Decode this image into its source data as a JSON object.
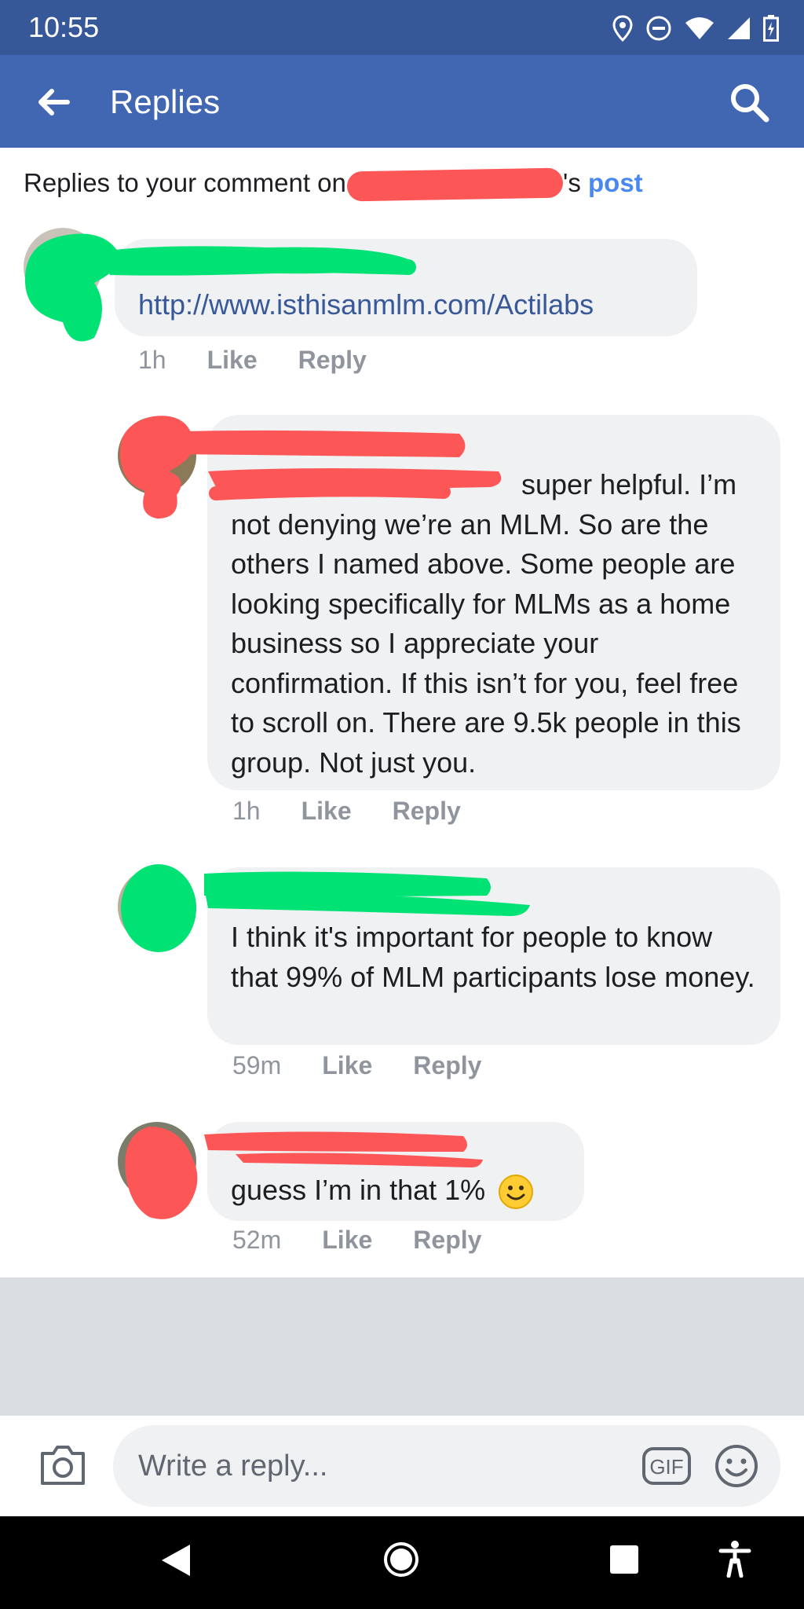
{
  "status_bar": {
    "time": "10:55",
    "icons": [
      "location-icon",
      "do-not-disturb-icon",
      "wifi-icon",
      "signal-icon",
      "battery-icon"
    ]
  },
  "app_bar": {
    "title": "Replies",
    "back_icon": "back-arrow-icon",
    "search_icon": "search-icon"
  },
  "subheader": {
    "prefix": "Replies to your comment on",
    "possessive": "'s",
    "link": "post"
  },
  "comments": [
    {
      "text": "http://www.isthisanmlm.com/Actilabs",
      "time": "1h",
      "like": "Like",
      "reply": "Reply",
      "is_link": true
    },
    {
      "text": "super helpful. I’m not denying we’re an MLM. So are the others I named above. Some people are looking specifically for MLMs as a home business so I appreciate your confirmation. If this isn’t for you, feel free to scroll on. There are 9.5k people in this group. Not just you.",
      "time": "1h",
      "like": "Like",
      "reply": "Reply"
    },
    {
      "text": "I think it's important for people to know that 99% of MLM participants lose money.",
      "time": "59m",
      "like": "Like",
      "reply": "Reply"
    },
    {
      "text": "guess I’m in that 1%",
      "time": "52m",
      "like": "Like",
      "reply": "Reply"
    }
  ],
  "compose": {
    "placeholder": "Write a reply...",
    "gif_label": "GIF"
  },
  "colors": {
    "status_bar": "#365899",
    "app_bar": "#4267b2",
    "link": "#4a88f1",
    "redaction_red": "#fd5656",
    "redaction_green": "#00e274"
  }
}
